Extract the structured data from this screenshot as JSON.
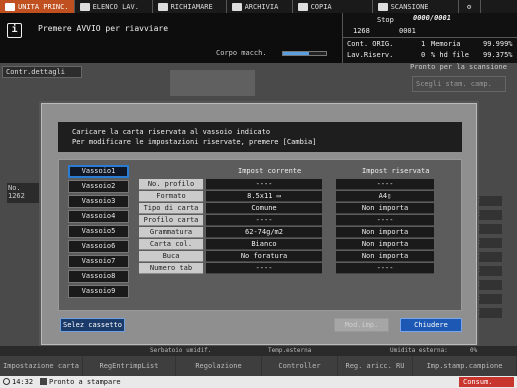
{
  "tabs": [
    {
      "label": "UNITA PRINC.",
      "active": true
    },
    {
      "label": "ELENCO LAV."
    },
    {
      "label": "RICHIAMARE"
    },
    {
      "label": "ARCHIVIA"
    },
    {
      "label": "COPIA"
    },
    {
      "label": "SCANSIONE"
    }
  ],
  "message": {
    "text": "Premere AVVIO per riavviare"
  },
  "corpo": {
    "label": "Corpo macch."
  },
  "status": {
    "state": "Stop",
    "counter": "0000/0001",
    "count_a": "1268",
    "count_b": "0001",
    "cont_orig_label": "Cont. ORIG.",
    "cont_orig_value": "1",
    "memoria_label": "Memoria",
    "memoria_value": "99.999%",
    "lav_riserv_label": "Lav.Riserv.",
    "lav_riserv_value": "0",
    "hd_file_label": "% hd file",
    "hd_file_value": "99.375%"
  },
  "main": {
    "cond_button": "Contr.dettagli",
    "pronto": "Pronto per la scansione",
    "scegli": "Scegli stam. camp.",
    "bg_list_label": "No.",
    "bg_list_value": "1262"
  },
  "dialog": {
    "msg_line1": "Caricare la carta riservata al vassoio indicato",
    "msg_line2": "Per modificare le impostazioni riservate, premere [Cambia]",
    "trays": [
      "Vassoio1",
      "Vassoio2",
      "Vassoio3",
      "Vassoio4",
      "Vassoio5",
      "Vassoio6",
      "Vassoio7",
      "Vassoio8",
      "Vassoio9"
    ],
    "selected_tray": "Vassoio1",
    "col_current": "Impost corrente",
    "col_reserved": "Impost riservata",
    "rows": [
      {
        "label": "No. profilo",
        "current": "----",
        "reserved": "----"
      },
      {
        "label": "Formato",
        "current": "8.5x11",
        "reserved": "A4"
      },
      {
        "label": "Tipo di carta",
        "current": "Comune",
        "reserved": "Non importa"
      },
      {
        "label": "Profilo carta",
        "current": "----",
        "reserved": "----"
      },
      {
        "label": "Grammatura",
        "current": "62-74g/m2",
        "reserved": "Non importa"
      },
      {
        "label": "Carta col.",
        "current": "Bianco",
        "reserved": "Non importa"
      },
      {
        "label": "Buca",
        "current": "No foratura",
        "reserved": "Non importa"
      },
      {
        "label": "Numero tab",
        "current": "----",
        "reserved": "----"
      }
    ],
    "btn_sel": "Selez cassetto",
    "btn_mod": "Mod.imp.",
    "btn_close": "Chiudere"
  },
  "lower": {
    "serbatoio": "Serbatoio umidif.",
    "temp_esterna": "Temp.esterna",
    "umidita_esterna": "Umidita esterna:",
    "umidita_value": "0%"
  },
  "bottom_tabs": [
    "Impostazione carta",
    "RegEntrimpList",
    "Regolazione",
    "Controller",
    "Reg. aricc. RU",
    "Imp.stamp.campione"
  ],
  "statusbar": {
    "time": "14:32",
    "state": "Pronto a stampare",
    "consumabili": "Consum."
  }
}
